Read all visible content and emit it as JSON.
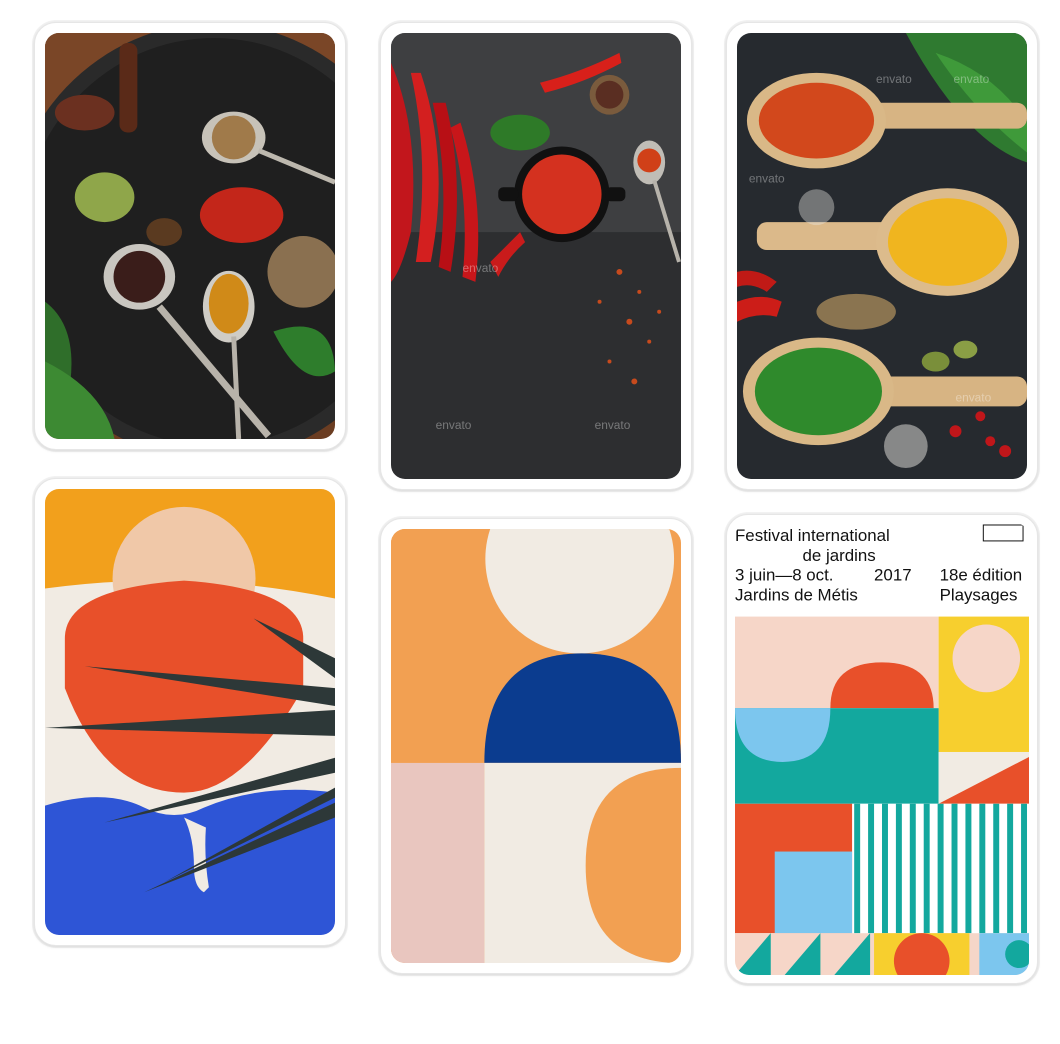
{
  "gallery": {
    "cards": [
      {
        "subject": "spices on dark plate with spoons"
      },
      {
        "subject": "red chili peppers and sauce bowl",
        "watermark": "envato"
      },
      {
        "subject": "spices in wooden spoons",
        "watermark": "envato"
      },
      {
        "subject": "abstract sunset with palm leaves"
      },
      {
        "subject": "abstract geometric shapes"
      },
      {
        "subject": "festival poster geometric garden"
      }
    ]
  },
  "poster": {
    "line1": "Festival international",
    "line2": "de jardins",
    "dates": "3 juin—8 oct.",
    "year": "2017",
    "edition": "18e édition",
    "venue": "Jardins de Métis",
    "theme": "Playsages"
  },
  "colors": {
    "orange": "#f2a01c",
    "red_orange": "#e8502a",
    "blue": "#2e55d6",
    "navy": "#0b3c8f",
    "teal": "#13a89e",
    "yellow": "#f7cf2e",
    "light_blue": "#7cc6ee",
    "pink": "#e9c6bf",
    "cream": "#f1ebe3"
  }
}
